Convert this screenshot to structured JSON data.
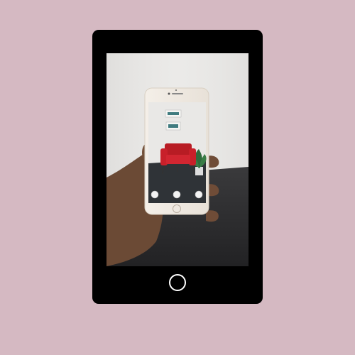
{
  "colors": {
    "background": "#d5b9c2",
    "device_frame": "#000000",
    "home_button": "#ffffff",
    "chair": "#c8202a",
    "wall": "#e9e8e6",
    "floor": "#2c2c2e"
  },
  "scene": {
    "subject": "hand-holding-phone-ar-chair",
    "phone_ui_buttons": [
      "circle-icon",
      "circle-icon",
      "circle-icon"
    ]
  }
}
